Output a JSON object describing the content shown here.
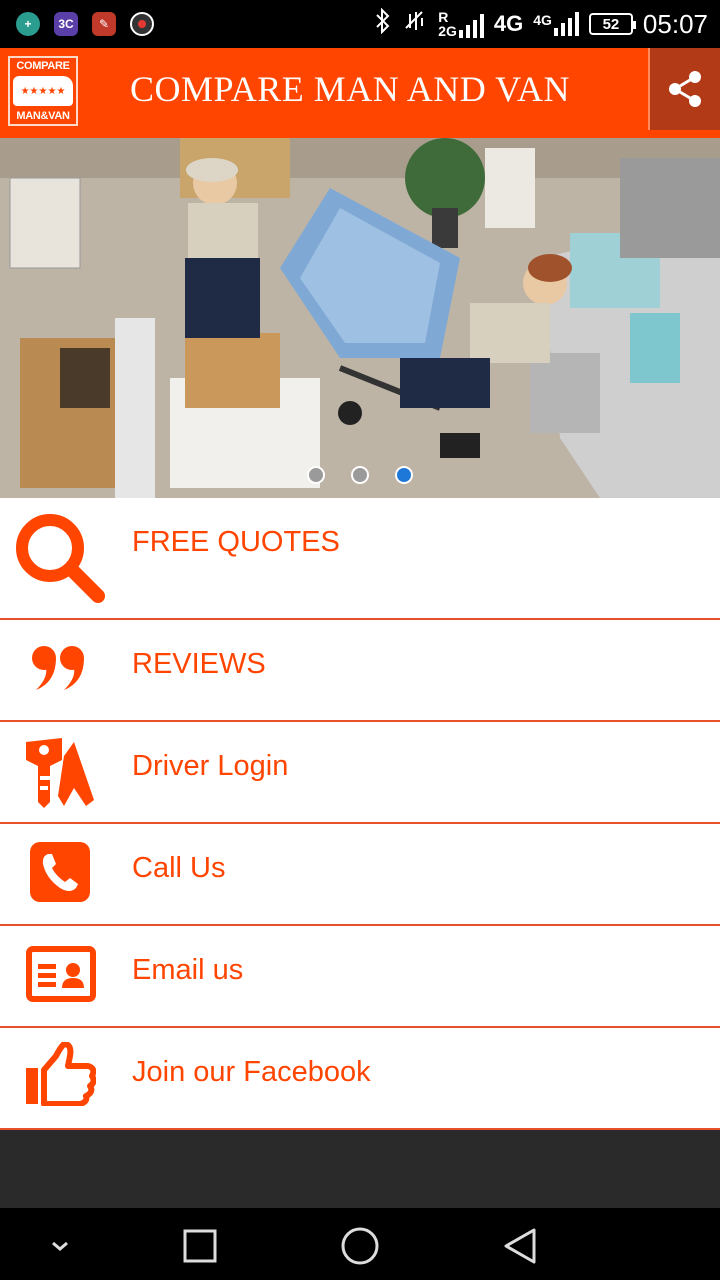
{
  "status_bar": {
    "network_roaming": "R",
    "network_2g": "2G",
    "network_4g_large": "4G",
    "network_4g_small": "4G",
    "battery": "52",
    "time": "05:07"
  },
  "app_bar": {
    "logo_top": "COMPARE",
    "logo_bottom": "MAN&VAN",
    "logo_stars": "★★★★★",
    "title": "COMPARE MAN AND VAN"
  },
  "carousel": {
    "slide_count": 3,
    "active_index": 2
  },
  "menu": {
    "items": [
      {
        "label": "FREE QUOTES",
        "icon": "search-icon"
      },
      {
        "label": "REVIEWS",
        "icon": "quote-icon"
      },
      {
        "label": "Driver Login",
        "icon": "key-icon"
      },
      {
        "label": "Call Us",
        "icon": "phone-icon"
      },
      {
        "label": "Email us",
        "icon": "contact-card-icon"
      },
      {
        "label": "Join our Facebook",
        "icon": "thumbs-up-icon"
      }
    ]
  },
  "colors": {
    "accent": "#ff4500",
    "accent_dark": "#b23a16",
    "divider": "#e8502a",
    "dot_active": "#1e78d8"
  }
}
